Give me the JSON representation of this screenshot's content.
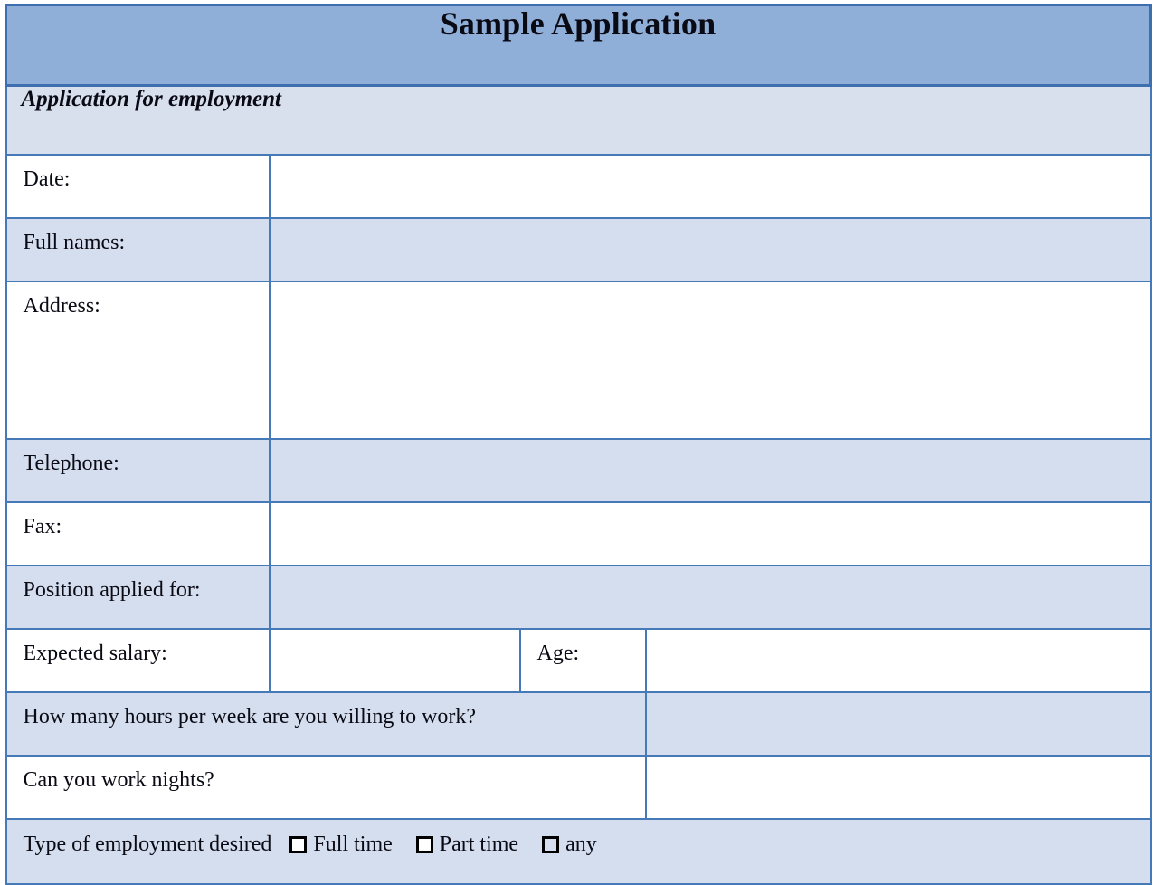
{
  "document": {
    "title": "Sample Application",
    "subtitle": "Application for employment"
  },
  "colors": {
    "header_fill": "#8FAED8",
    "header_border": "#3C6EB0",
    "grid_border": "#4579B8",
    "row_tint": "#D5DEEE",
    "subtitle_fill": "#D8E0EE",
    "row_white": "#FFFFFF",
    "text": "#0A0A14"
  },
  "fields": [
    {
      "label": "Date:",
      "value": ""
    },
    {
      "label": "Full names:",
      "value": ""
    },
    {
      "label": "Address:",
      "value": ""
    },
    {
      "label": "Telephone:",
      "value": ""
    },
    {
      "label": "Fax:",
      "value": ""
    },
    {
      "label": "Position applied for:",
      "value": ""
    }
  ],
  "salary_row": {
    "salary_label": "Expected salary:",
    "salary_value": "",
    "age_label": "Age:",
    "age_value": ""
  },
  "questions": [
    {
      "label": "How many hours per week are you willing to work?",
      "value": ""
    },
    {
      "label": "Can you work nights?",
      "value": ""
    }
  ],
  "employment_type": {
    "prompt": "Type of employment desired",
    "options": [
      {
        "label": "Full time",
        "checked": false
      },
      {
        "label": "Part time",
        "checked": false
      },
      {
        "label": "any",
        "checked": false
      }
    ]
  }
}
